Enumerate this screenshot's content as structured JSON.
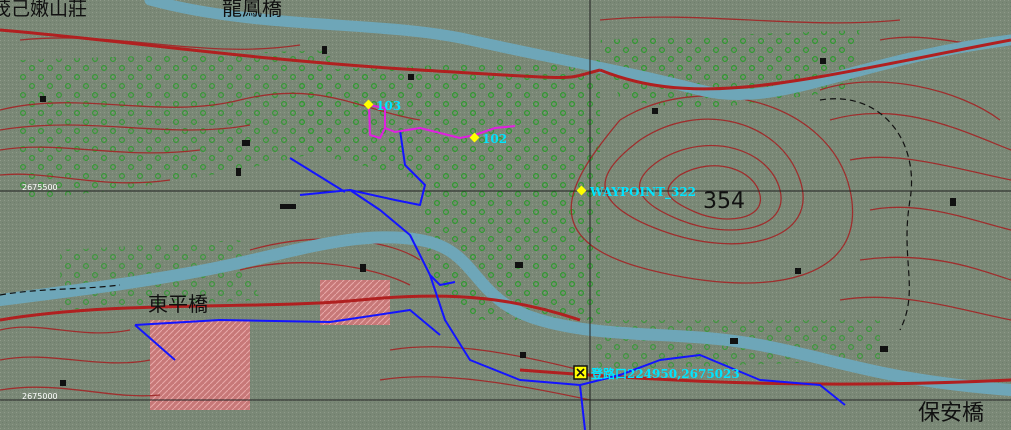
{
  "map": {
    "place_names": {
      "village_top_left": "茂己嫩山莊",
      "bridge_top": "龍鳳橋",
      "bridge_left": "東平橋",
      "bridge_bottom_right": "保安橋"
    },
    "elevation_label": "354",
    "grid_labels": {
      "northing_upper": "2675500",
      "northing_lower": "2675000"
    },
    "waypoints": {
      "wp_103": "103",
      "wp_102": "102",
      "wp_322": "WAYPOINT_322",
      "trailhead": "登路口224950,2675023"
    },
    "colors": {
      "background": "#7d8a78",
      "contour": "#a02a2a",
      "river": "#6ea6b8",
      "road": "#b02020",
      "track_blue": "#1414ff",
      "track_magenta": "#e020e0",
      "waypoint_marker": "#ffff00",
      "waypoint_label": "#00e5ff",
      "orchard_dots": "#2f8f2f",
      "cultivated_area": "#c77070"
    }
  }
}
